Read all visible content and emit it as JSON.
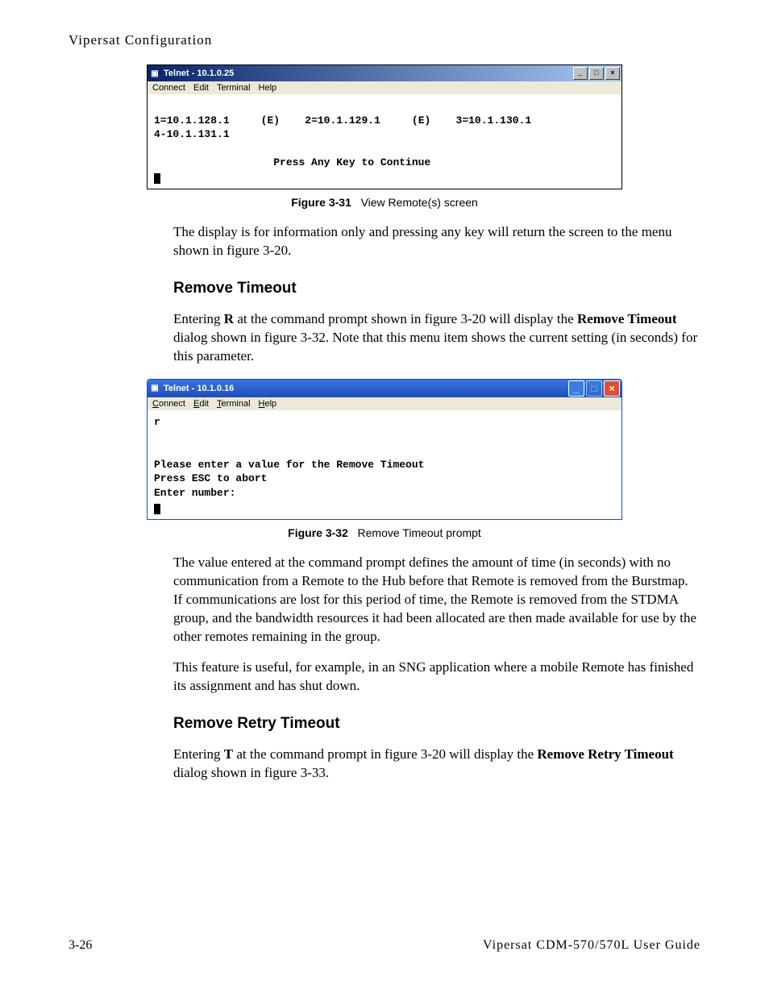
{
  "header": "Vipersat Configuration",
  "terminal1": {
    "title": "Telnet - 10.1.0.25",
    "menu": {
      "connect": "Connect",
      "edit": "Edit",
      "terminal": "Terminal",
      "help": "Help"
    },
    "line1a": "1=10.1.128.1",
    "line1b": "(E)",
    "line1c": "2=10.1.129.1",
    "line1d": "(E)",
    "line1e": "3=10.1.130.1",
    "line2": "4-10.1.131.1",
    "line3": "Press Any Key to Continue"
  },
  "figure1": {
    "label": "Figure 3-31",
    "caption": "View Remote(s) screen"
  },
  "para1": "The display is for information only and pressing any key will return the screen to the menu shown in figure 3-20.",
  "section1": "Remove Timeout",
  "para2a": "Entering ",
  "para2b": "R",
  "para2c": " at the command prompt shown in figure 3-20 will display the ",
  "para2d": "Remove Timeout",
  "para2e": " dialog shown in figure 3-32. Note that this menu item shows the current setting (in seconds) for this parameter.",
  "terminal2": {
    "title": "Telnet - 10.1.0.16",
    "menu": {
      "connect": "Connect",
      "edit": "Edit",
      "terminal": "Terminal",
      "help": "Help"
    },
    "line1": "r",
    "line2": "Please enter a value for the Remove Timeout",
    "line3": "Press ESC to abort",
    "line4": "Enter number:"
  },
  "figure2": {
    "label": "Figure 3-32",
    "caption": "Remove Timeout prompt"
  },
  "para3": "The value entered at the command prompt defines the amount of time (in seconds) with no communication from a Remote to the Hub before that Remote is removed from the Burstmap. If communications are lost for this period of time, the Remote is removed from the STDMA group, and the bandwidth resources it had been allocated are then made available for use by the other remotes remaining in the group.",
  "para4": "This feature is useful, for example, in an SNG application where a mobile Remote has finished its assignment and has shut down.",
  "section2": "Remove Retry Timeout",
  "para5a": "Entering ",
  "para5b": "T",
  "para5c": " at the command prompt in figure 3-20 will display the ",
  "para5d": "Remove Retry Timeout",
  "para5e": " dialog shown in figure 3-33.",
  "footer": {
    "left": "3-26",
    "right": "Vipersat CDM-570/570L User Guide"
  }
}
